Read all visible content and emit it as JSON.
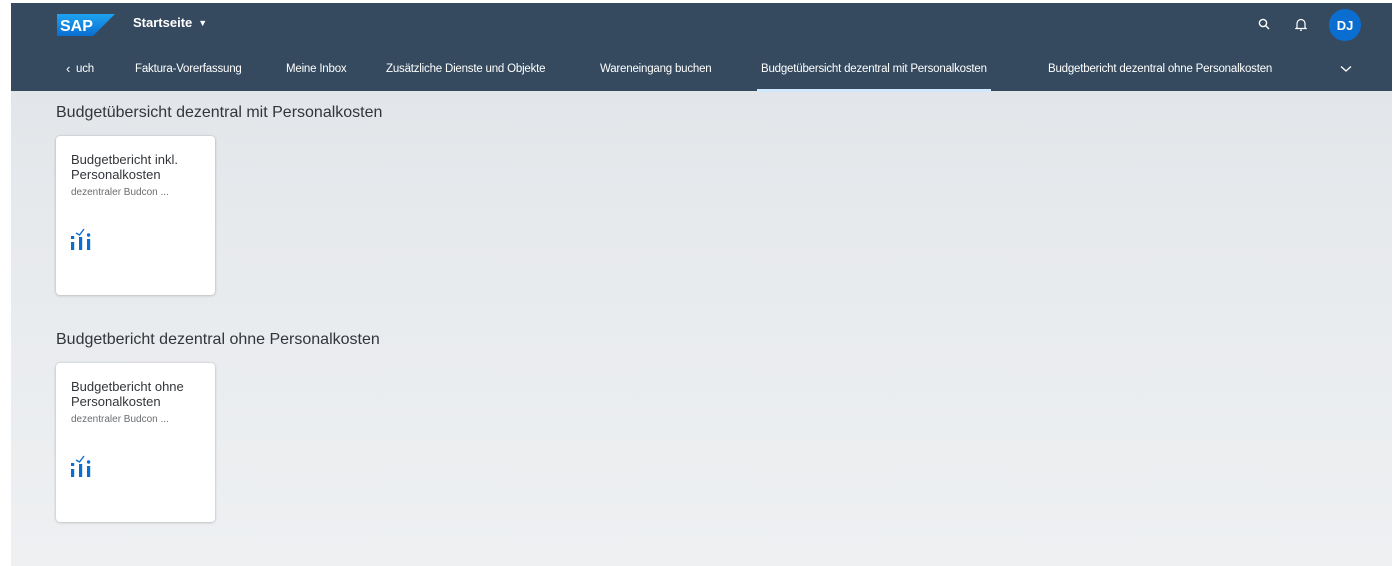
{
  "shell": {
    "logo_text": "SAP",
    "home_title": "Startseite",
    "user_initials": "DJ",
    "colors": {
      "bar": "#354a5f",
      "avatar": "#0a6ed1",
      "icon": "#0a6ed1"
    }
  },
  "tabs": [
    {
      "label": "uch"
    },
    {
      "label": "Faktura-Vorerfassung"
    },
    {
      "label": "Meine Inbox"
    },
    {
      "label": "Zusätzliche Dienste und Objekte"
    },
    {
      "label": "Wareneingang buchen"
    },
    {
      "label": "Budgetübersicht dezentral mit Personalkosten",
      "active": true
    },
    {
      "label": "Budgetbericht dezentral ohne Personalkosten"
    }
  ],
  "sections": [
    {
      "title": "Budgetübersicht dezentral mit Personalkosten",
      "tiles": [
        {
          "title": "Budgetbericht inkl. Personalkosten",
          "subtitle": "dezentraler Budcon ...",
          "icon": "analytics-icon"
        }
      ]
    },
    {
      "title": "Budgetbericht dezentral ohne Personalkosten",
      "tiles": [
        {
          "title": "Budgetbericht ohne Personalkosten",
          "subtitle": "dezentraler Budcon ...",
          "icon": "analytics-icon"
        }
      ]
    }
  ]
}
